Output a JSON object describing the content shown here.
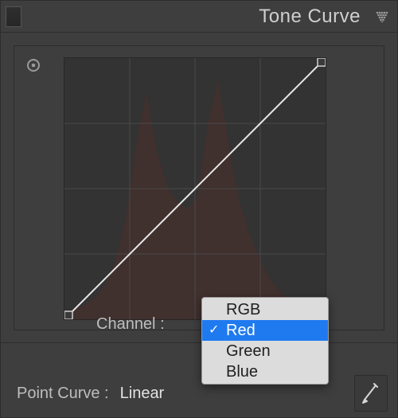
{
  "header": {
    "title": "Tone Curve"
  },
  "channel": {
    "label": "Channel",
    "options": [
      "RGB",
      "Red",
      "Green",
      "Blue"
    ],
    "selected": "Red"
  },
  "point_curve": {
    "label": "Point Curve",
    "value": "Linear"
  },
  "chart_data": {
    "type": "line",
    "title": "Tone Curve",
    "curve_points": [
      {
        "x": 0,
        "y": 0
      },
      {
        "x": 255,
        "y": 255
      }
    ],
    "xlim": [
      0,
      255
    ],
    "ylim": [
      0,
      255
    ],
    "grid_divisions": 4,
    "histogram_color": "#4b2e2a",
    "histogram": [
      {
        "x": 0,
        "y": 8
      },
      {
        "x": 10,
        "y": 10
      },
      {
        "x": 20,
        "y": 14
      },
      {
        "x": 30,
        "y": 22
      },
      {
        "x": 40,
        "y": 34
      },
      {
        "x": 50,
        "y": 58
      },
      {
        "x": 60,
        "y": 100
      },
      {
        "x": 70,
        "y": 170
      },
      {
        "x": 80,
        "y": 220
      },
      {
        "x": 90,
        "y": 165
      },
      {
        "x": 100,
        "y": 130
      },
      {
        "x": 110,
        "y": 115
      },
      {
        "x": 120,
        "y": 108
      },
      {
        "x": 130,
        "y": 120
      },
      {
        "x": 140,
        "y": 190
      },
      {
        "x": 150,
        "y": 235
      },
      {
        "x": 160,
        "y": 172
      },
      {
        "x": 170,
        "y": 118
      },
      {
        "x": 180,
        "y": 85
      },
      {
        "x": 190,
        "y": 60
      },
      {
        "x": 200,
        "y": 40
      },
      {
        "x": 210,
        "y": 28
      },
      {
        "x": 220,
        "y": 18
      },
      {
        "x": 230,
        "y": 12
      },
      {
        "x": 240,
        "y": 8
      },
      {
        "x": 255,
        "y": 5
      }
    ]
  },
  "icons": {
    "panel_menu": "dotted-triangle-icon",
    "targeted_adjust": "target-icon",
    "edit_curve": "pencil-icon"
  }
}
